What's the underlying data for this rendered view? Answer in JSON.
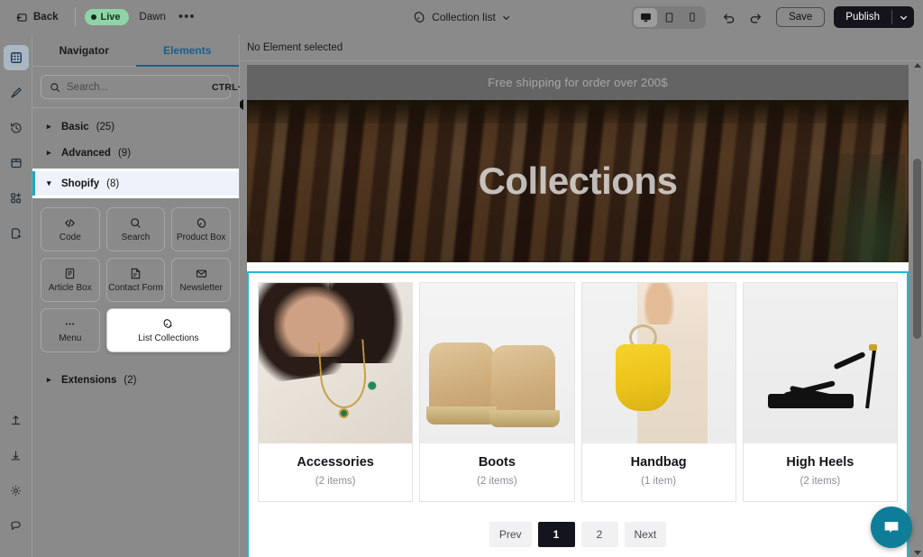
{
  "topbar": {
    "back_label": "Back",
    "status_label": "Live",
    "theme_name": "Dawn",
    "more_label": "•••",
    "page_selector_label": "Collection list",
    "devices": [
      {
        "name": "desktop",
        "active": true
      },
      {
        "name": "tablet",
        "active": false
      },
      {
        "name": "mobile",
        "active": false
      }
    ],
    "undo_label": "Undo",
    "redo_label": "Redo",
    "save_label": "Save",
    "publish_label": "Publish"
  },
  "rail": {
    "items": [
      {
        "name": "layers-icon",
        "active": true
      },
      {
        "name": "paint-brush-icon",
        "active": false
      },
      {
        "name": "history-icon",
        "active": false
      },
      {
        "name": "package-icon",
        "active": false
      },
      {
        "name": "apps-add-icon",
        "active": false
      },
      {
        "name": "page-add-icon",
        "active": false
      }
    ],
    "bottom_items": [
      {
        "name": "upload-icon"
      },
      {
        "name": "download-icon"
      },
      {
        "name": "settings-gear-icon"
      },
      {
        "name": "feedback-chat-icon"
      }
    ]
  },
  "panel": {
    "tabs": [
      {
        "label": "Navigator",
        "active": false
      },
      {
        "label": "Elements",
        "active": true
      }
    ],
    "search": {
      "placeholder": "Search...",
      "value": "",
      "shortcut": "CTRL+K"
    },
    "categories": [
      {
        "label": "Basic",
        "count": "(25)",
        "expanded": false,
        "selected": false
      },
      {
        "label": "Advanced",
        "count": "(9)",
        "expanded": false,
        "selected": false
      },
      {
        "label": "Shopify",
        "count": "(8)",
        "expanded": true,
        "selected": true
      }
    ],
    "extensions": {
      "label": "Extensions",
      "count": "(2)",
      "expanded": false
    },
    "tiles": [
      {
        "label": "Code",
        "icon": "code-icon",
        "selected": false
      },
      {
        "label": "Search",
        "icon": "search-icon",
        "selected": false
      },
      {
        "label": "Product Box",
        "icon": "product-box-icon",
        "selected": false
      },
      {
        "label": "Article Box",
        "icon": "article-box-icon",
        "selected": false
      },
      {
        "label": "Contact Form",
        "icon": "contact-form-icon",
        "selected": false
      },
      {
        "label": "Newsletter",
        "icon": "newsletter-icon",
        "selected": false
      },
      {
        "label": "Menu",
        "icon": "menu-dots-icon",
        "selected": false
      },
      {
        "label": "List Collections",
        "icon": "list-collections-icon",
        "selected": true
      }
    ]
  },
  "canvas": {
    "selection_status": "No Element selected",
    "announcement_bar": "Free shipping for order over 200$",
    "hero_title": "Collections",
    "collections": [
      {
        "title": "Accessories",
        "items": "(2 items)"
      },
      {
        "title": "Boots",
        "items": "(2 items)"
      },
      {
        "title": "Handbag",
        "items": "(1 item)"
      },
      {
        "title": "High Heels",
        "items": "(2 items)"
      }
    ],
    "pagination": [
      {
        "label": "Prev",
        "active": false
      },
      {
        "label": "1",
        "active": true
      },
      {
        "label": "2",
        "active": false
      },
      {
        "label": "Next",
        "active": false
      }
    ]
  },
  "chat_widget": {
    "name": "chat-launcher"
  },
  "colors": {
    "selection_accent": "#22b8d4",
    "tab_accent": "#1d5f8a",
    "live_badge": "#8fd4a8",
    "publish_bg": "#14141f",
    "chat_bg": "#0e7d98"
  }
}
